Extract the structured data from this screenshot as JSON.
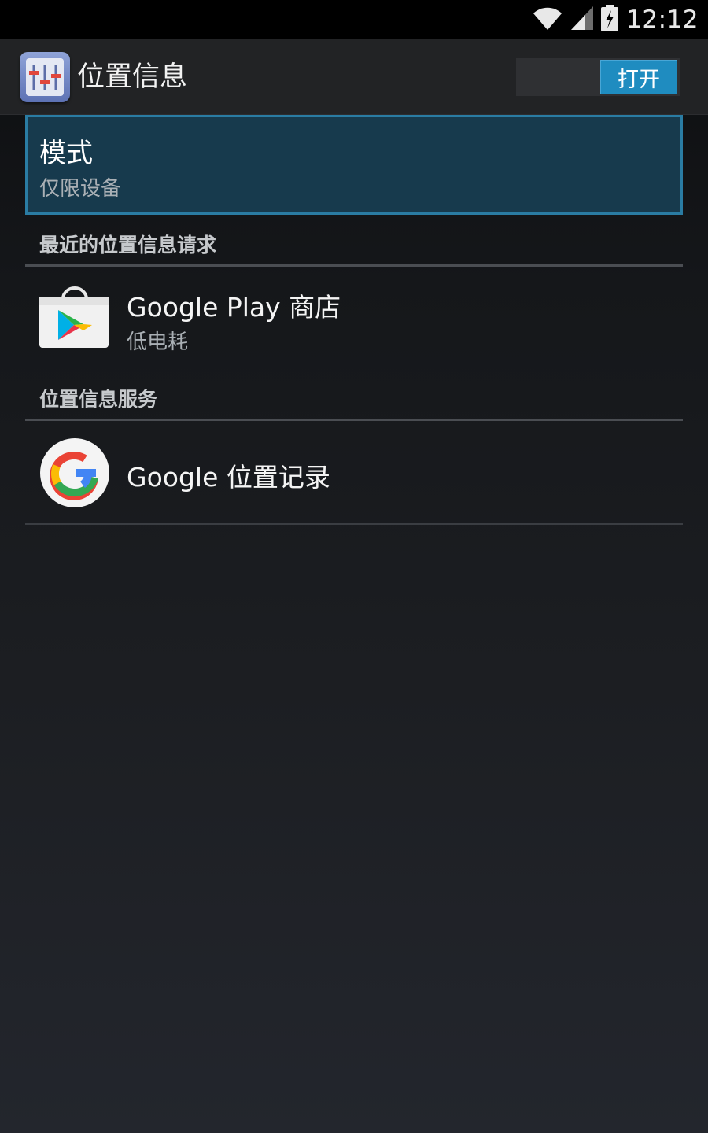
{
  "status_bar": {
    "time": "12:12",
    "icons": [
      "wifi-icon",
      "cell-signal-icon",
      "battery-charging-icon"
    ]
  },
  "action_bar": {
    "title": "位置信息",
    "app_icon": "equalizer-settings-icon",
    "toggle_label": "打开",
    "toggle_state": "on"
  },
  "mode": {
    "title": "模式",
    "value": "仅限设备"
  },
  "recent_requests": {
    "header": "最近的位置信息请求",
    "items": [
      {
        "title": "Google Play 商店",
        "subtitle": "低电耗",
        "icon": "google-play-store-icon"
      }
    ]
  },
  "location_services": {
    "header": "位置信息服务",
    "items": [
      {
        "title": "Google 位置记录",
        "icon": "google-g-icon"
      }
    ]
  },
  "colors": {
    "accent": "#1f8cc0",
    "highlight_bg": "#173a4d",
    "highlight_border": "#2a7ca3"
  }
}
